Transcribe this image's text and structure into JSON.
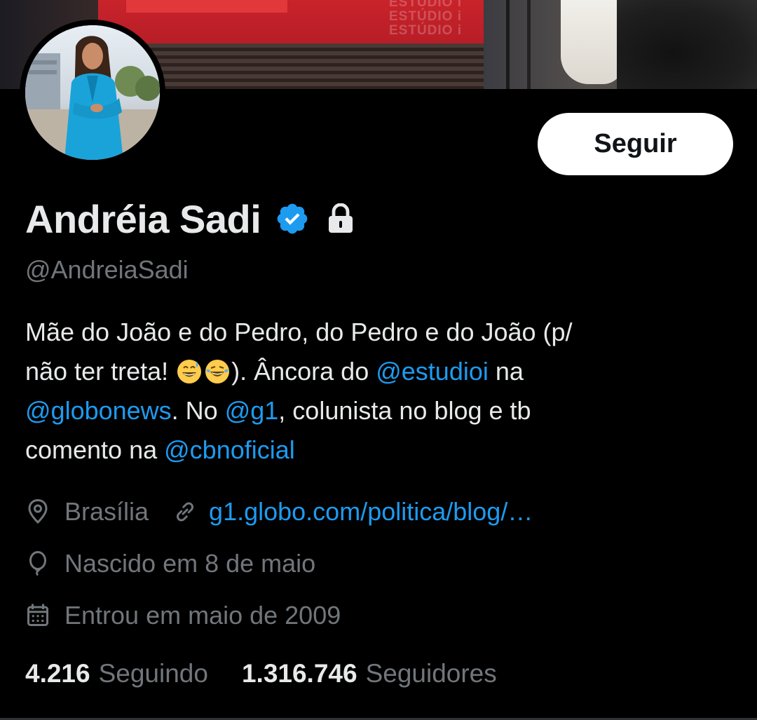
{
  "profile": {
    "display_name": "Andréia Sadi",
    "handle": "@AndreiaSadi",
    "verified": true,
    "protected": true,
    "follow_label": "Seguir"
  },
  "bio": {
    "line1": "Mãe do João e do Pedro, do Pedro e do João (p/",
    "line2_text": "não ter treta! ",
    "line2_after": "). Âncora do ",
    "line2_mention": "@estudioi",
    "line2_end": " na",
    "line3_mention1": "@globonews",
    "line3_mid": ". No ",
    "line3_mention2": "@g1",
    "line3_end": ", colunista no blog e tb",
    "line4_text": "comento na ",
    "line4_mention": "@cbnoficial"
  },
  "meta": {
    "location": "Brasília",
    "website": "g1.globo.com/politica/blog/…",
    "birthday": "Nascido em 8 de maio",
    "joined": "Entrou em maio de 2009"
  },
  "stats": {
    "following_count": "4.216",
    "following_label": "Seguindo",
    "followers_count": "1.316.746",
    "followers_label": "Seguidores"
  },
  "banner": {
    "brand_line1": "ESTÚDIO i",
    "brand_line2": "ESTÚDIO i",
    "brand_line3": "ESTÚDIO i"
  },
  "icons": {
    "verified": "verified-badge-icon",
    "lock": "lock-icon",
    "location": "location-pin-icon",
    "link": "link-icon",
    "birthday": "balloon-icon",
    "calendar": "calendar-icon"
  },
  "colors": {
    "background": "#000000",
    "text_primary": "#e7e9ea",
    "text_secondary": "#71767b",
    "link": "#1d9bf0",
    "verified": "#1d9bf0"
  }
}
